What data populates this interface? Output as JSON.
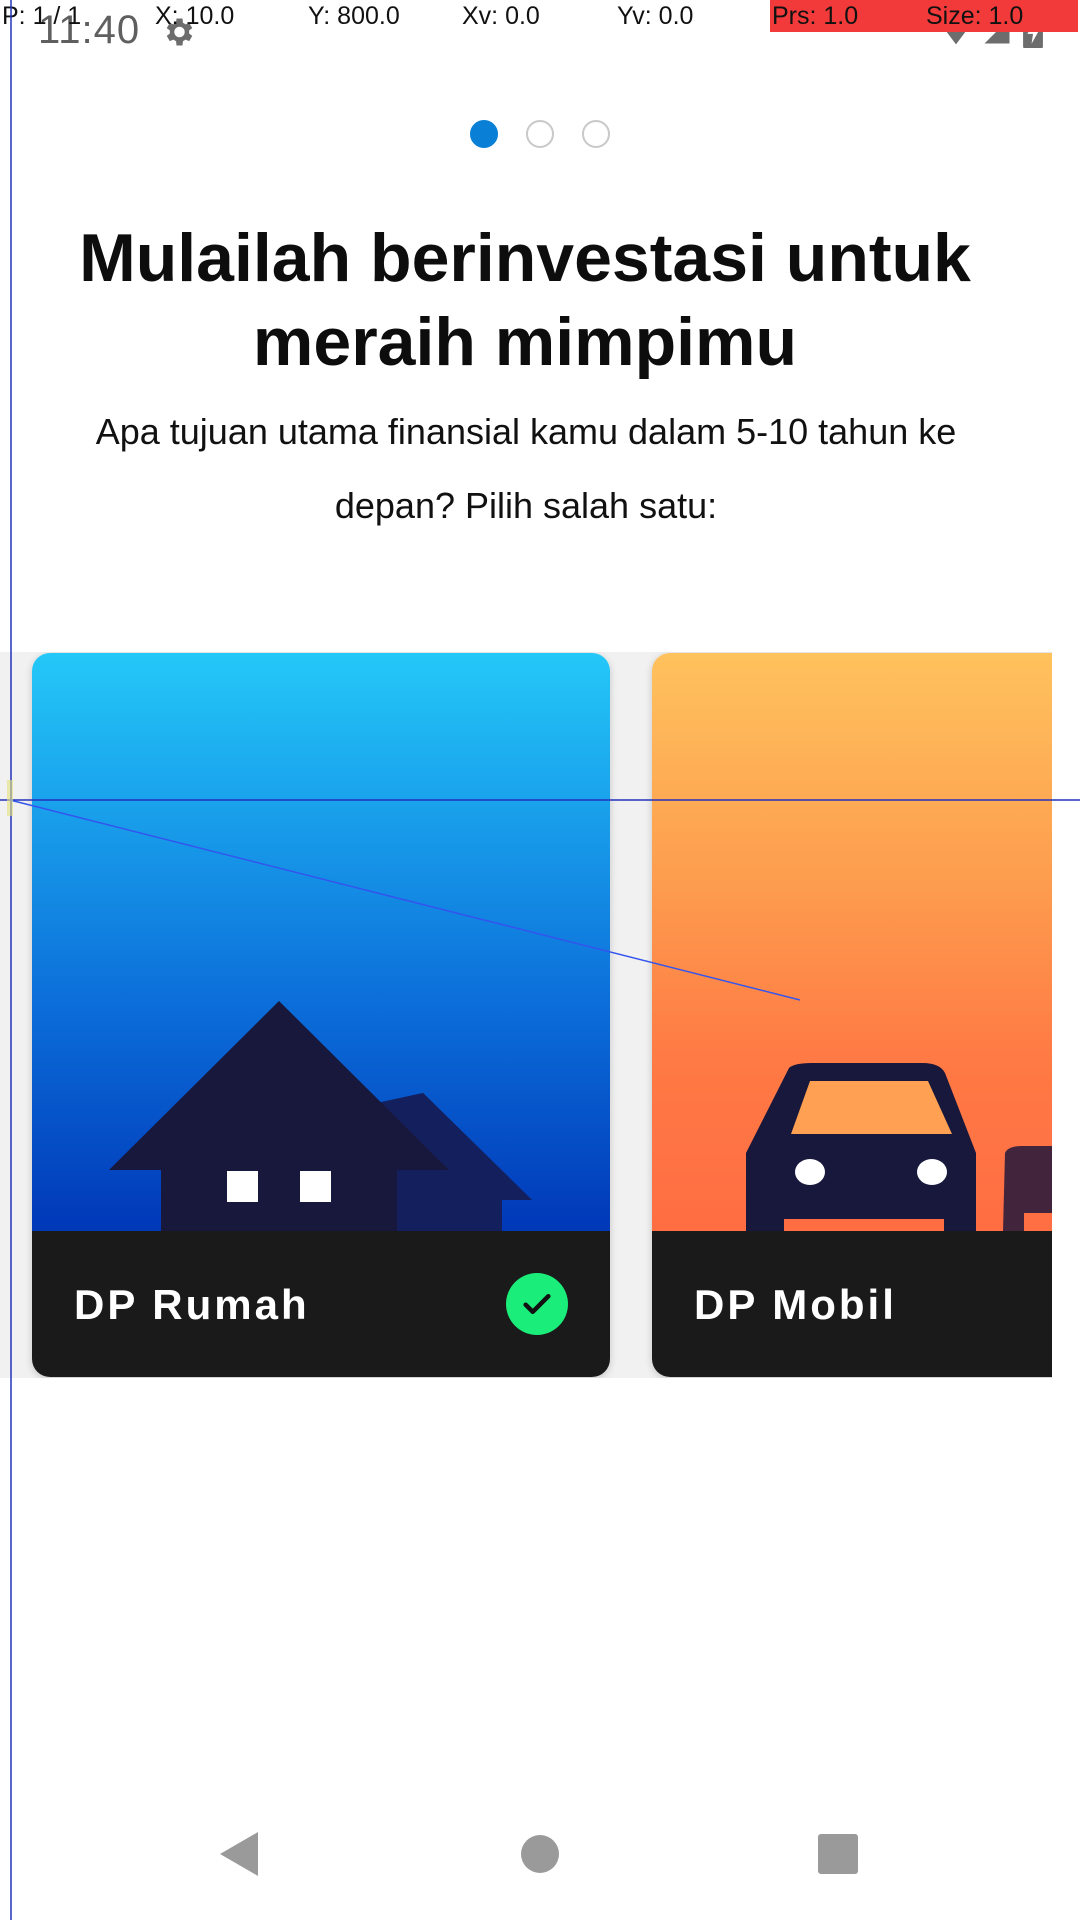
{
  "status_bar": {
    "time": "11:40",
    "settings_icon": "gear-icon",
    "wifi_icon": "wifi-icon",
    "signal_icon": "cell-signal-icon",
    "battery_icon": "battery-charging-icon"
  },
  "debug_overlay": {
    "pointer": "P: 1 / 1",
    "x": "X: 10.0",
    "y": "Y: 800.0",
    "xv": "Xv: 0.0",
    "yv": "Yv: 0.0",
    "pressure": "Prs: 1.0",
    "size": "Size: 1.0"
  },
  "pager": {
    "total": 3,
    "active_index": 0,
    "active_color": "#0a7fd6"
  },
  "heading": {
    "title": "Mulailah berinvestasi untuk meraih mimpimu",
    "subtitle": "Apa tujuan utama finansial kamu dalam 5-10 tahun ke depan? Pilih salah satu:"
  },
  "cards": [
    {
      "label": "DP Rumah",
      "icon": "house-icon",
      "selected": true,
      "check_icon": "checkmark-icon",
      "accent": "#1aed7a"
    },
    {
      "label": "DP Mobil",
      "icon": "car-icon",
      "selected": false
    }
  ],
  "nav_bar": {
    "back_icon": "back-triangle-icon",
    "home_icon": "home-circle-icon",
    "recents_icon": "recents-square-icon"
  }
}
